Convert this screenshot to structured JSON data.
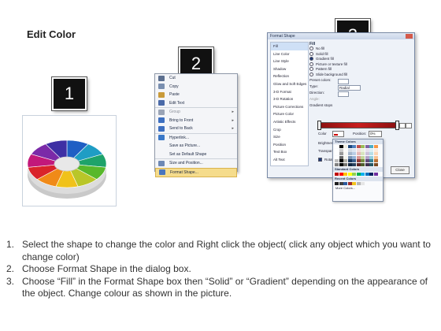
{
  "title": "Edit Color",
  "steps": {
    "one": "1",
    "two": "2",
    "three": "3"
  },
  "ring_colors": [
    "#1f5fc4",
    "#1f9dc4",
    "#1ea36a",
    "#58b82b",
    "#b9c629",
    "#f0c21a",
    "#f08a18",
    "#d9242a",
    "#c2187a",
    "#7b2aa8",
    "#3e2fa4"
  ],
  "context_menu": {
    "items": [
      {
        "label": "Cut",
        "icon": "scissors-icon",
        "icon_color": "#5c6f8f"
      },
      {
        "label": "Copy",
        "icon": "copy-icon",
        "icon_color": "#7a8fb0"
      },
      {
        "label": "Paste",
        "icon": "paste-icon",
        "icon_color": "#c99a3a"
      },
      {
        "label": "Edit Text",
        "icon": "edit-text-icon",
        "icon_color": "#4a6aa8"
      },
      {
        "label": "Group",
        "icon": "group-icon",
        "icon_color": "#9aa4b6",
        "disabled": true,
        "submenu": true
      },
      {
        "label": "Bring to Front",
        "icon": "bring-front-icon",
        "icon_color": "#3d6fc0",
        "submenu": true
      },
      {
        "label": "Send to Back",
        "icon": "send-back-icon",
        "icon_color": "#3d6fc0",
        "submenu": true
      },
      {
        "label": "Hyperlink...",
        "icon": "hyperlink-icon",
        "icon_color": "#3a78c8"
      },
      {
        "label": "Save as Picture...",
        "icon": "",
        "icon_color": ""
      },
      {
        "label": "Set as Default Shape",
        "icon": "",
        "icon_color": ""
      },
      {
        "label": "Size and Position...",
        "icon": "size-position-icon",
        "icon_color": "#6d88b5"
      },
      {
        "label": "Format Shape...",
        "icon": "format-shape-icon",
        "icon_color": "#4a76bd",
        "highlighted": true
      }
    ]
  },
  "dialog": {
    "title": "Format Shape",
    "nav": [
      "Fill",
      "Line Color",
      "Line Style",
      "Shadow",
      "Reflection",
      "Glow and Soft Edges",
      "3-D Format",
      "3-D Rotation",
      "Picture Corrections",
      "Picture Color",
      "Artistic Effects",
      "Crop",
      "Size",
      "Position",
      "Text Box",
      "Alt Text"
    ],
    "selected_nav": "Fill",
    "fill_heading": "Fill",
    "fill_options": [
      "No fill",
      "Solid fill",
      "Gradient fill",
      "Picture or texture fill",
      "Pattern fill",
      "Slide background fill"
    ],
    "selected_fill": "Gradient fill",
    "preset_colors_label": "Preset colors:",
    "type_label": "Type:",
    "type_value": "Radial",
    "direction_label": "Direction:",
    "angle_label": "Angle:",
    "gradient_stops_label": "Gradient stops",
    "color_label": "Color",
    "position_label": "Position:",
    "position_value": "0%",
    "brightness_label": "Brightness:",
    "transparency_label": "Transparency:",
    "rotate_label": "Rotate with shape",
    "close_label": "Close"
  },
  "palette": {
    "theme_heading": "Theme Colors",
    "standard_heading": "Standard Colors",
    "recent_heading": "Recent Colors",
    "more_colors": "More Colors...",
    "theme_top": [
      "#ffffff",
      "#000000",
      "#eeece1",
      "#1f497d",
      "#4f81bd",
      "#c0504d",
      "#9bbb59",
      "#8064a2",
      "#4bacc6",
      "#f79646"
    ],
    "standard": [
      "#c00000",
      "#ff0000",
      "#ffc000",
      "#ffff00",
      "#92d050",
      "#00b050",
      "#00b0f0",
      "#0070c0",
      "#002060",
      "#7030a0"
    ],
    "recent": [
      "#1f1f1f",
      "#3f3f3f",
      "#2e5c9e",
      "#9c2a2a",
      "#f2c320",
      "#b5b5b5",
      "#e6e6e6"
    ]
  },
  "instructions": [
    {
      "num": "1.",
      "text": "Select the shape to change the color and Right click the object( click any object which you want to change color)"
    },
    {
      "num": "2.",
      "text": "Choose Format Shape in the dialog box."
    },
    {
      "num": "3.",
      "text": "Choose “Fill” in the Format Shape box then “Solid” or “Gradient” depending on the appearance of the object. Change colour as shown in the picture."
    }
  ]
}
